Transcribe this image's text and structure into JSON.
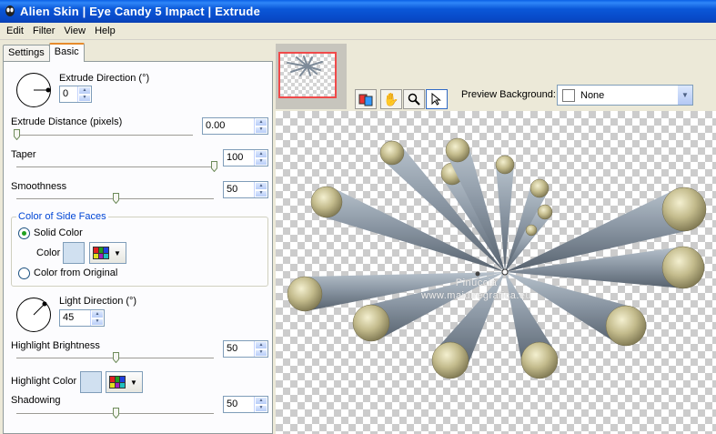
{
  "window": {
    "title": "Alien Skin | Eye Candy 5 Impact | Extrude"
  },
  "menu": [
    "Edit",
    "Filter",
    "View",
    "Help"
  ],
  "tabs": {
    "settings": "Settings",
    "basic": "Basic"
  },
  "controls": {
    "extrude_direction": {
      "label": "Extrude Direction (°)",
      "value": "0"
    },
    "extrude_distance": {
      "label": "Extrude Distance (pixels)",
      "value": "0.00",
      "slider_fraction": 0.0
    },
    "taper": {
      "label": "Taper",
      "value": "100",
      "slider_fraction": 1.0
    },
    "smoothness": {
      "label": "Smoothness",
      "value": "50",
      "slider_fraction": 0.5
    },
    "side_faces": {
      "title": "Color of Side Faces",
      "solid_color": "Solid Color",
      "color_label": "Color",
      "from_original": "Color from Original",
      "swatch_color": "#d0e0f0"
    },
    "light_direction": {
      "label": "Light Direction (°)",
      "value": "45"
    },
    "highlight_brightness": {
      "label": "Highlight Brightness",
      "value": "50",
      "slider_fraction": 0.5
    },
    "highlight_color": {
      "label": "Highlight Color",
      "swatch_color": "#d0e0f0"
    },
    "shadowing": {
      "label": "Shadowing",
      "value": "50",
      "slider_fraction": 0.5
    }
  },
  "preview": {
    "background_label": "Preview Background:",
    "background_value": "None",
    "watermark_line1": "Pinuccia",
    "watermark_line2": "www.maidiregrafica.eu"
  },
  "colors": {
    "cone": "#7d8a98",
    "cap": "#bdb68a",
    "accent_tab": "#e68b2c"
  }
}
